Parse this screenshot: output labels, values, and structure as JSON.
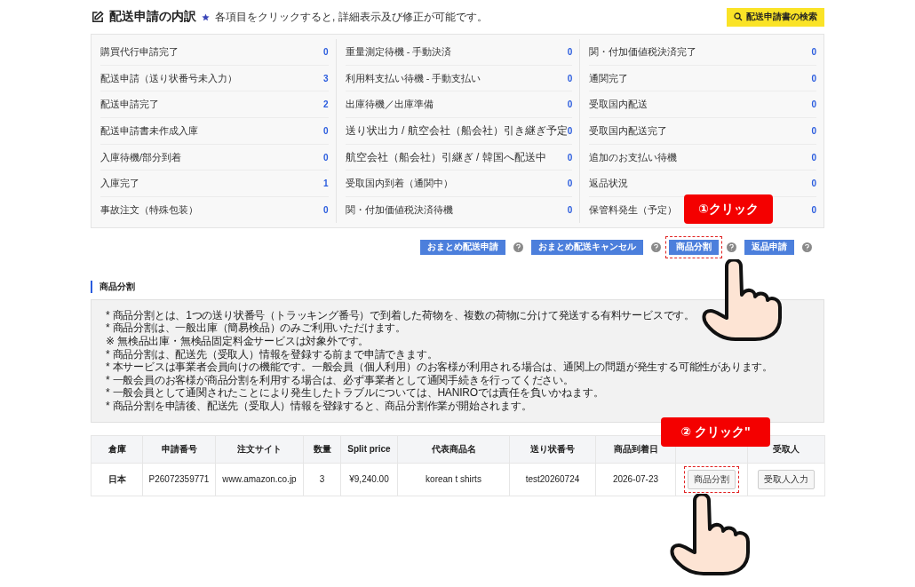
{
  "header": {
    "title": "配送申請の内訳",
    "hint": "各項目をクリックすると, 詳細表示及び修正が可能です。",
    "search_button": "配送申請書の検索"
  },
  "status_columns": [
    {
      "items": [
        {
          "label": "購買代行申請完了",
          "count": "0"
        },
        {
          "label": "配送申請（送り状番号未入力）",
          "count": "3"
        },
        {
          "label": "配送申請完了",
          "count": "2"
        },
        {
          "label": "配送申請書未作成入庫",
          "count": "0"
        },
        {
          "label": "入庫待機/部分到着",
          "count": "0"
        },
        {
          "label": "入庫完了",
          "count": "1"
        },
        {
          "label": "事故注文（特殊包装）",
          "count": "0"
        }
      ]
    },
    {
      "items": [
        {
          "label": "重量測定待機 - 手動決済",
          "count": "0"
        },
        {
          "label": "利用料支払い待機 - 手動支払い",
          "count": "0"
        },
        {
          "label": "出庫待機／出庫準備",
          "count": "0"
        },
        {
          "label": "送り状出力 / 航空会社（船会社）引き継ぎ予定",
          "count": "0"
        },
        {
          "label": "航空会社（船会社）引継ぎ / 韓国へ配送中",
          "count": "0"
        },
        {
          "label": "受取国内到着（通関中）",
          "count": "0"
        },
        {
          "label": "関・付加価値税決済待機",
          "count": "0"
        }
      ]
    },
    {
      "items": [
        {
          "label": "関・付加価値税決済完了",
          "count": "0"
        },
        {
          "label": "通関完了",
          "count": "0"
        },
        {
          "label": "受取国内配送",
          "count": "0"
        },
        {
          "label": "受取国内配送完了",
          "count": "0"
        },
        {
          "label": "追加のお支払い待機",
          "count": "0"
        },
        {
          "label": "返品状況",
          "count": "0"
        },
        {
          "label": "保管料発生（予定）",
          "count": "0"
        }
      ]
    }
  ],
  "actions": [
    {
      "label": "おまとめ配送申請",
      "highlighted": false
    },
    {
      "label": "おまとめ配送キャンセル",
      "highlighted": false
    },
    {
      "label": "商品分割",
      "highlighted": true
    },
    {
      "label": "返品申請",
      "highlighted": false
    }
  ],
  "section": {
    "title": "商品分割",
    "notes": [
      "*  商品分割とは、1つの送り状番号（トラッキング番号）で到着した荷物を、複数の荷物に分けて発送する有料サービスです。",
      "*  商品分割は、一般出庫（簡易検品）のみご利用いただけます。",
      "※  無検品出庫・無検品固定料金サービスは対象外です。",
      "*  商品分割は、配送先（受取人）情報を登録する前まで申請できます。",
      "*  本サービスは事業者会員向けの機能です。一般会員（個人利用）のお客様が利用される場合は、通関上の問題が発生する可能性があります。",
      "*  一般会員のお客様が商品分割を利用する場合は、必ず事業者として通関手続きを行ってください。",
      "*  一般会員として通関されたことにより発生したトラブルについては、HANIROでは責任を負いかねます。",
      "*  商品分割を申請後、配送先（受取人）情報を登録すると、商品分割作業が開始されます。"
    ]
  },
  "table": {
    "columns": [
      "倉庫",
      "申請番号",
      "注文サイト",
      "数量",
      "Split price",
      "代表商品名",
      "送り状番号",
      "商品到着日",
      "受取人"
    ],
    "rows": [
      {
        "cells": [
          "日本",
          "P26072359771",
          "www.amazon.co.jp",
          "3",
          "¥9,240.00",
          "korean t shirts",
          "test20260724",
          "2026-07-23"
        ],
        "actions": [
          {
            "label": "商品分割",
            "highlighted": true
          },
          {
            "label": "受取人入力",
            "highlighted": false
          }
        ]
      }
    ]
  },
  "callouts": [
    {
      "label": "①クリック"
    },
    {
      "label": "② クリック\""
    }
  ]
}
